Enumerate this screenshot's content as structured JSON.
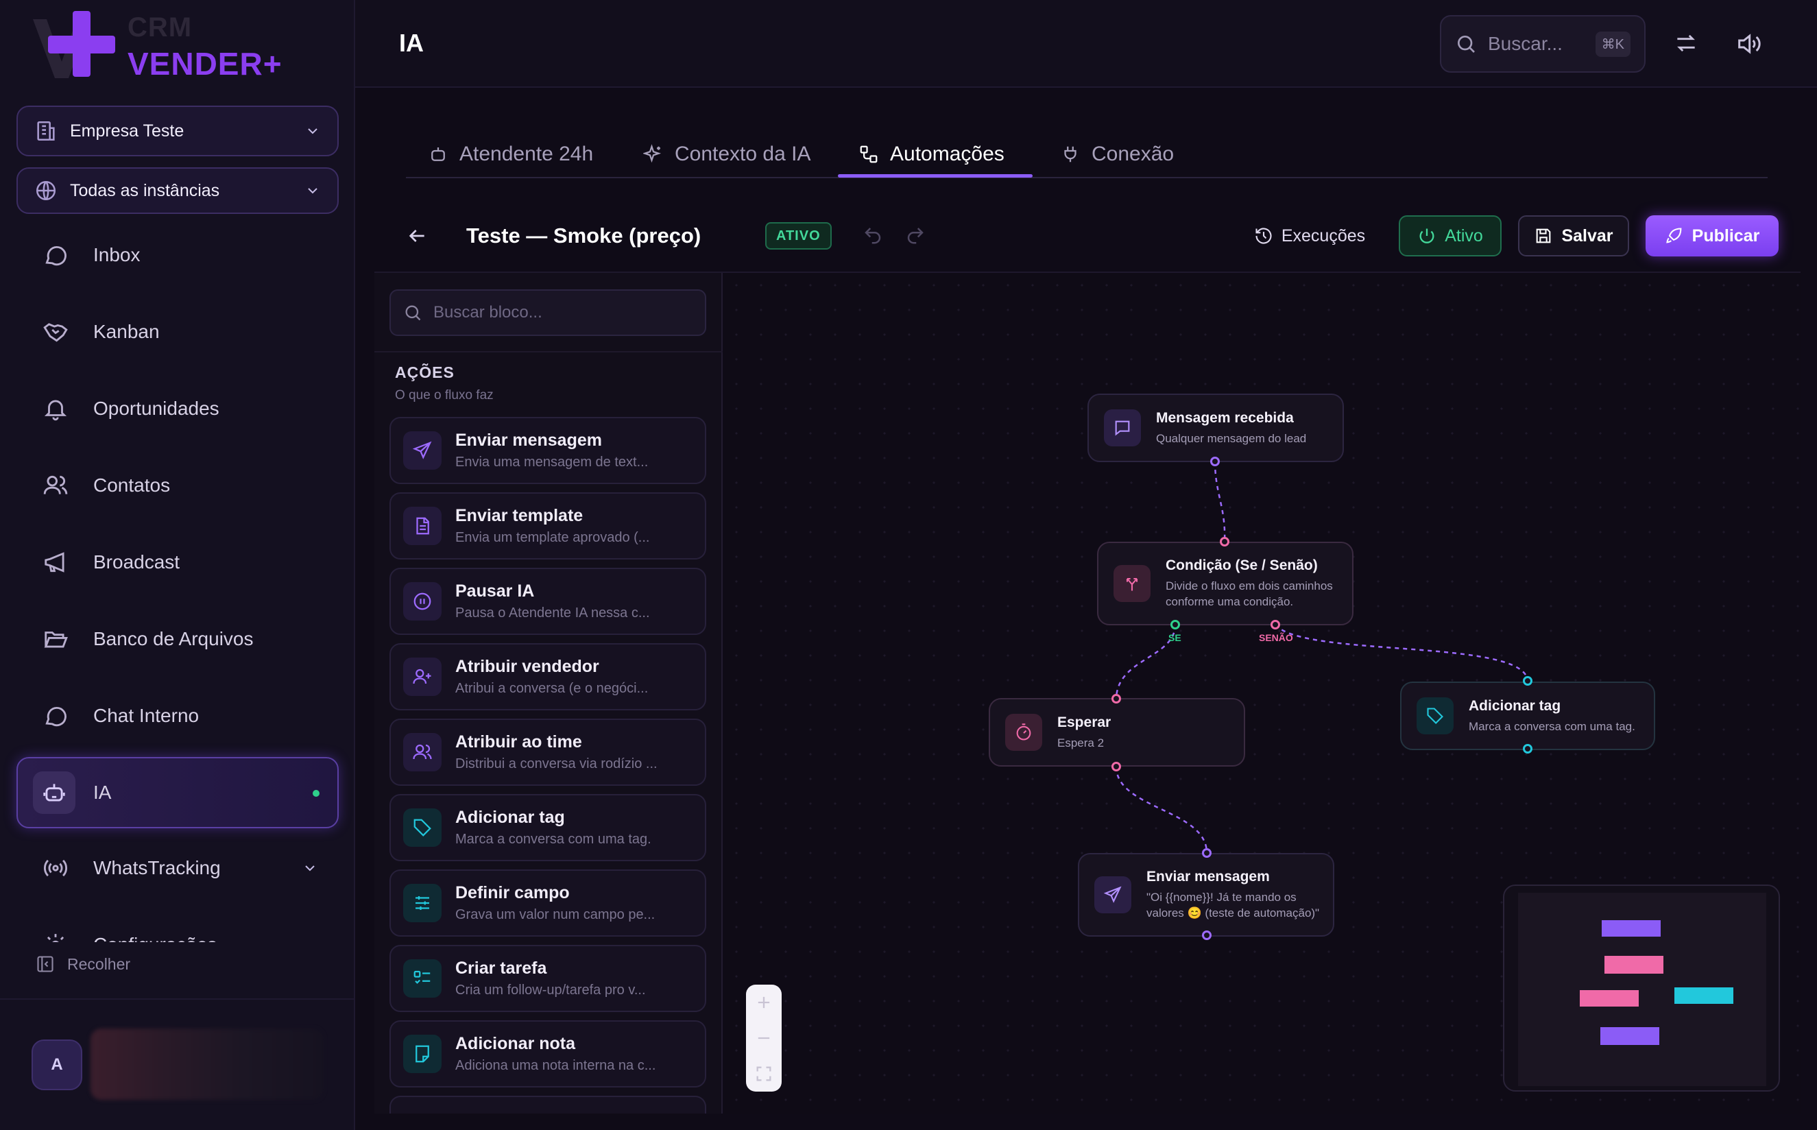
{
  "logo": {
    "line1": "CRM",
    "line2": "VENDER+"
  },
  "sidebar": {
    "company_select": "Empresa Teste",
    "instance_select": "Todas as instâncias",
    "items": [
      {
        "label": "Inbox",
        "icon": "chat-bubble-icon"
      },
      {
        "label": "Kanban",
        "icon": "handshake-icon"
      },
      {
        "label": "Oportunidades",
        "icon": "bell-icon"
      },
      {
        "label": "Contatos",
        "icon": "users-icon"
      },
      {
        "label": "Broadcast",
        "icon": "megaphone-icon"
      },
      {
        "label": "Banco de Arquivos",
        "icon": "folder-open-icon"
      },
      {
        "label": "Chat Interno",
        "icon": "chat-bubble-icon"
      },
      {
        "label": "IA",
        "icon": "robot-icon",
        "active": true
      },
      {
        "label": "WhatsTracking",
        "icon": "broadcast-signal-icon"
      },
      {
        "label": "Configurações",
        "icon": "gear-icon"
      }
    ],
    "collapse_label": "Recolher",
    "avatar_initial": "A"
  },
  "header": {
    "title": "IA",
    "search_placeholder": "Buscar...",
    "search_shortcut": "⌘K"
  },
  "tabs": [
    {
      "label": "Atendente 24h",
      "icon": "robot-icon"
    },
    {
      "label": "Contexto da IA",
      "icon": "sparkles-icon"
    },
    {
      "label": "Automações",
      "icon": "workflow-icon",
      "active": true
    },
    {
      "label": "Conexão",
      "icon": "plug-icon"
    }
  ],
  "flow": {
    "name": "Teste — Smoke (preço)",
    "status_badge": "ATIVO",
    "executions_label": "Execuções",
    "active_toggle_label": "Ativo",
    "save_label": "Salvar",
    "publish_label": "Publicar"
  },
  "library": {
    "search_placeholder": "Buscar bloco...",
    "section_title": "AÇÕES",
    "section_subtitle": "O que o fluxo faz",
    "blocks": [
      {
        "title": "Enviar mensagem",
        "desc": "Envia uma mensagem de text...",
        "icon": "send-icon",
        "color": "#9d6bff"
      },
      {
        "title": "Enviar template",
        "desc": "Envia um template aprovado (...",
        "icon": "document-icon",
        "color": "#9d6bff"
      },
      {
        "title": "Pausar IA",
        "desc": "Pausa o Atendente IA nessa c...",
        "icon": "pause-circle-icon",
        "color": "#9d6bff"
      },
      {
        "title": "Atribuir vendedor",
        "desc": "Atribui a conversa (e o negóci...",
        "icon": "user-plus-icon",
        "color": "#9d6bff"
      },
      {
        "title": "Atribuir ao time",
        "desc": "Distribui a conversa via rodízio ...",
        "icon": "users-icon",
        "color": "#9d6bff"
      },
      {
        "title": "Adicionar tag",
        "desc": "Marca a conversa com uma tag.",
        "icon": "tag-icon",
        "color": "#22c8dc"
      },
      {
        "title": "Definir campo",
        "desc": "Grava um valor num campo pe...",
        "icon": "sliders-icon",
        "color": "#22c8dc"
      },
      {
        "title": "Criar tarefa",
        "desc": "Cria um follow-up/tarefa pro v...",
        "icon": "checklist-icon",
        "color": "#22c8dc"
      },
      {
        "title": "Adicionar nota",
        "desc": "Adiciona uma nota interna na c...",
        "icon": "note-icon",
        "color": "#22c8dc"
      }
    ]
  },
  "canvas": {
    "nodes": [
      {
        "id": "trigger",
        "title": "Mensagem recebida",
        "desc": "Qualquer mensagem do lead",
        "icon": "chat-bubble-icon"
      },
      {
        "id": "condition",
        "title": "Condição (Se / Senão)",
        "desc": "Divide o fluxo em dois caminhos conforme uma condição.",
        "icon": "split-arrows-icon"
      },
      {
        "id": "wait",
        "title": "Esperar",
        "desc": "Espera 2",
        "icon": "timer-icon"
      },
      {
        "id": "tag",
        "title": "Adicionar tag",
        "desc": "Marca a conversa com uma tag.",
        "icon": "tag-icon"
      },
      {
        "id": "send",
        "title": "Enviar mensagem",
        "desc": "\"Oi {{nome}}! Já te mando os valores 😊 (teste de automação)\"",
        "icon": "send-icon"
      }
    ],
    "branch_yes": "SE",
    "branch_no": "SENÃO"
  },
  "colors": {
    "accent": "#8b3ef0",
    "pink": "#f06aa8",
    "cyan": "#22c8dc",
    "green": "#2fd08c"
  }
}
